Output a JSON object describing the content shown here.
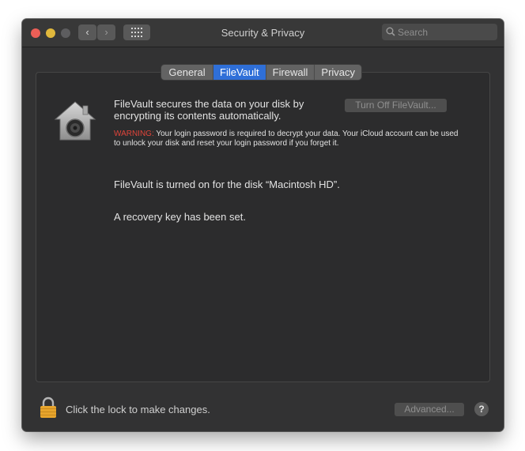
{
  "window": {
    "title": "Security & Privacy",
    "nav_back": "‹",
    "nav_forward": "›",
    "grid_icon": "grid-icon"
  },
  "search": {
    "placeholder": "Search",
    "value": ""
  },
  "tabs": [
    {
      "label": "General",
      "active": false
    },
    {
      "label": "FileVault",
      "active": true
    },
    {
      "label": "Firewall",
      "active": false
    },
    {
      "label": "Privacy",
      "active": false
    }
  ],
  "filevault": {
    "description": "FileVault secures the data on your disk by encrypting its contents automatically.",
    "turn_off_button": "Turn Off FileVault...",
    "warning_label": "WARNING:",
    "warning_text": " Your login password is required to decrypt your data. Your iCloud account can be used to unlock your disk and reset your login password if you forget it.",
    "status_disk": "FileVault is turned on for the disk “Macintosh HD”.",
    "status_recovery": "A recovery key has been set."
  },
  "footer": {
    "lock_text": "Click the lock to make changes.",
    "advanced_button": "Advanced...",
    "help_button": "?"
  },
  "colors": {
    "window_bg": "#323233",
    "panel_bg": "#2c2c2d",
    "tab_active": "#2f6fd8",
    "warning": "#e0443a",
    "close": "#ec5f57",
    "minimize": "#e0b83c"
  }
}
